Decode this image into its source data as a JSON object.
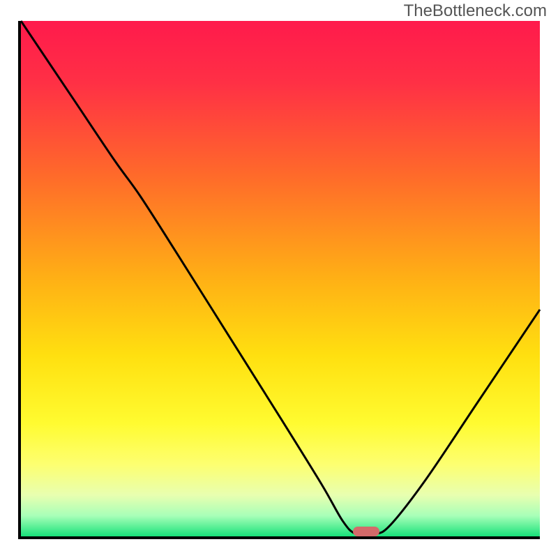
{
  "watermark": "TheBottleneck.com",
  "chart_data": {
    "type": "line",
    "title": "",
    "xlabel": "",
    "ylabel": "",
    "xlim": [
      0,
      100
    ],
    "ylim": [
      0,
      100
    ],
    "gradient_stops": [
      {
        "offset": 0.0,
        "color": "#ff1a4c"
      },
      {
        "offset": 0.12,
        "color": "#ff3045"
      },
      {
        "offset": 0.3,
        "color": "#ff6a2a"
      },
      {
        "offset": 0.5,
        "color": "#ffb015"
      },
      {
        "offset": 0.65,
        "color": "#ffe010"
      },
      {
        "offset": 0.78,
        "color": "#fffb30"
      },
      {
        "offset": 0.86,
        "color": "#fdff70"
      },
      {
        "offset": 0.92,
        "color": "#e8ffb0"
      },
      {
        "offset": 0.96,
        "color": "#a8ffb8"
      },
      {
        "offset": 1.0,
        "color": "#18e27a"
      }
    ],
    "series": [
      {
        "name": "bottleneck-curve",
        "points": [
          {
            "x": 0.0,
            "y": 100.0
          },
          {
            "x": 10.0,
            "y": 85.0
          },
          {
            "x": 18.0,
            "y": 73.0
          },
          {
            "x": 23.0,
            "y": 66.0
          },
          {
            "x": 30.0,
            "y": 55.0
          },
          {
            "x": 40.0,
            "y": 39.0
          },
          {
            "x": 50.0,
            "y": 23.0
          },
          {
            "x": 58.0,
            "y": 10.0
          },
          {
            "x": 62.0,
            "y": 3.0
          },
          {
            "x": 64.5,
            "y": 0.5
          },
          {
            "x": 68.0,
            "y": 0.5
          },
          {
            "x": 71.0,
            "y": 2.0
          },
          {
            "x": 78.0,
            "y": 11.0
          },
          {
            "x": 88.0,
            "y": 26.0
          },
          {
            "x": 100.0,
            "y": 44.0
          }
        ]
      }
    ],
    "marker": {
      "x": 66.5,
      "y": 0.9,
      "color": "#d46a6a"
    }
  }
}
